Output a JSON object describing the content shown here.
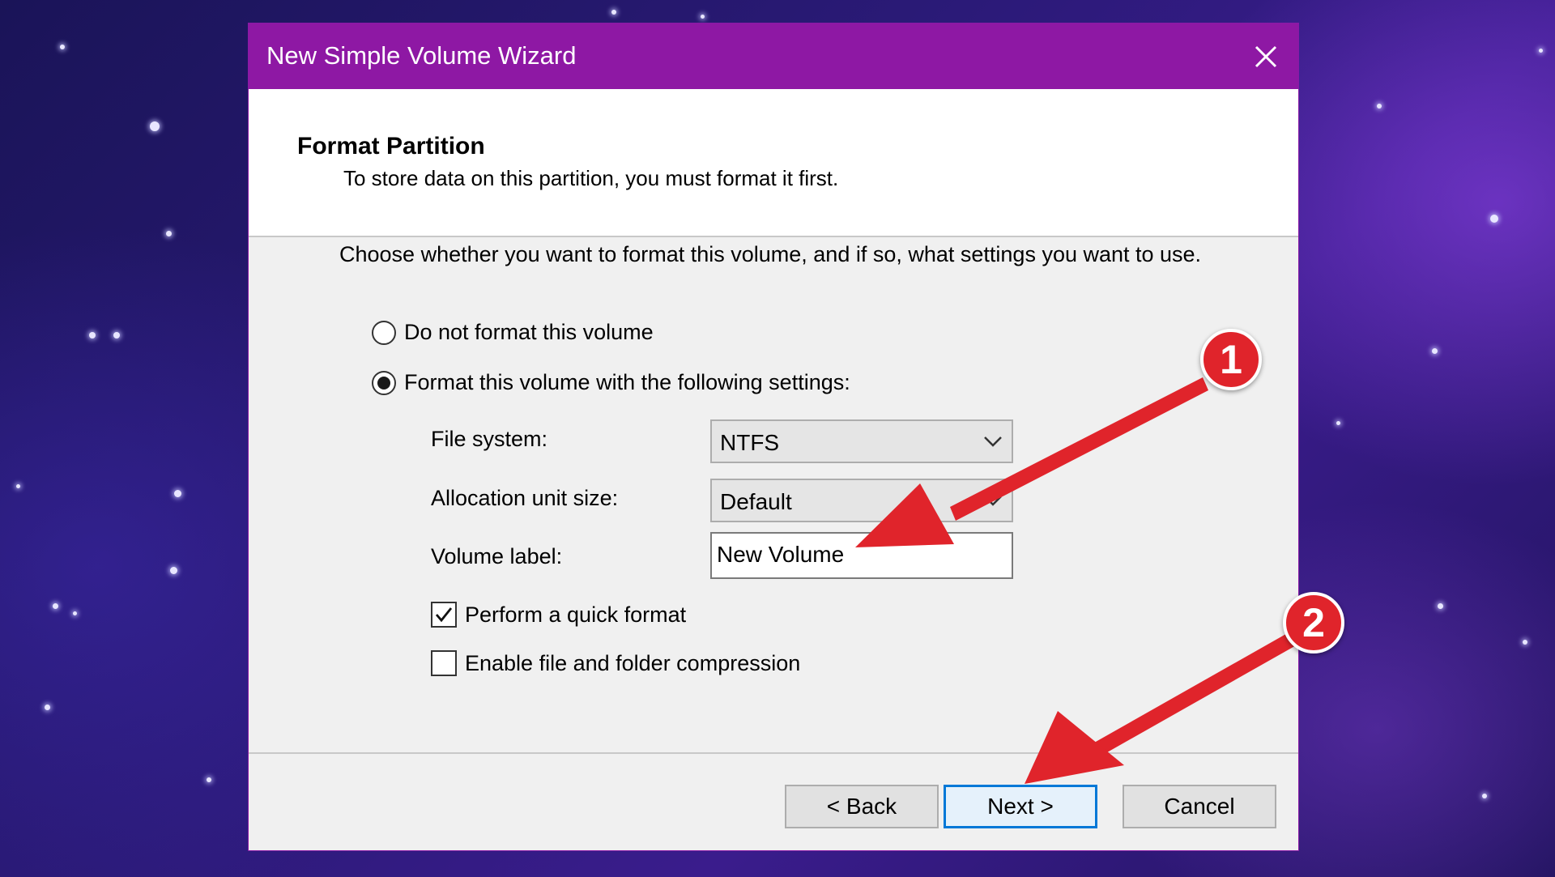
{
  "window": {
    "title": "New Simple Volume Wizard"
  },
  "header": {
    "title": "Format Partition",
    "subtitle": "To store data on this partition, you must format it first."
  },
  "instruction": "Choose whether you want to format this volume, and if so, what settings you want to use.",
  "options": {
    "no_format": {
      "label": "Do not format this volume",
      "selected": false
    },
    "format": {
      "label": "Format this volume with the following settings:",
      "selected": true
    }
  },
  "fields": {
    "file_system": {
      "label": "File system:",
      "value": "NTFS"
    },
    "allocation_unit_size": {
      "label": "Allocation unit size:",
      "value": "Default"
    },
    "volume_label": {
      "label": "Volume label:",
      "value": "New Volume"
    }
  },
  "checkboxes": {
    "quick_format": {
      "label": "Perform a quick format",
      "checked": true
    },
    "compression": {
      "label": "Enable file and folder compression",
      "checked": false
    }
  },
  "buttons": {
    "back": "< Back",
    "next": "Next >",
    "cancel": "Cancel"
  },
  "annotations": {
    "badge1": "1",
    "badge2": "2",
    "arrow_color": "#e0242b"
  },
  "colors": {
    "titlebar": "#8e18a4",
    "primary_border": "#0078d7"
  },
  "icons": {
    "close": "close-icon",
    "dropdown": "chevron-down-icon",
    "check": "checkmark-icon"
  }
}
